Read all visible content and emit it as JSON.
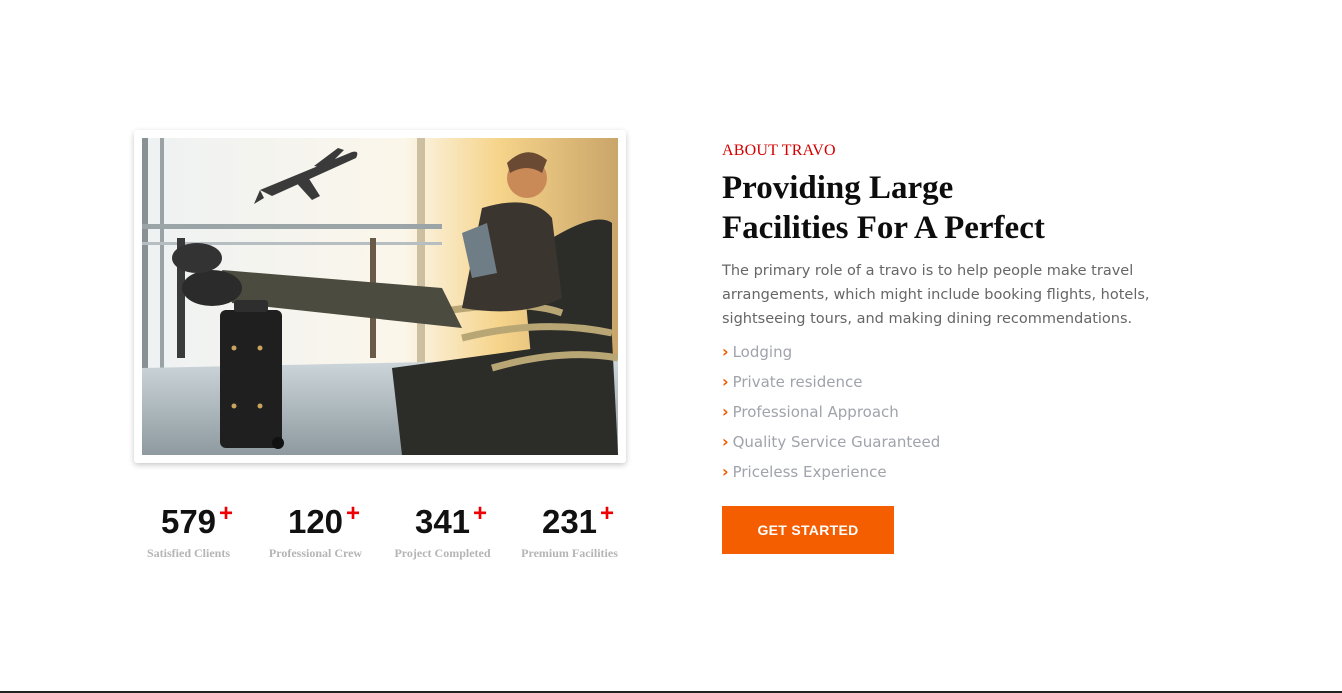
{
  "about": {
    "eyebrow": "ABOUT TRAVO",
    "heading_line1": "Providing Large",
    "heading_line2": "Facilities For A Perfect",
    "description": "The primary role of a travo is to help people make travel arrangements, which might include booking flights, hotels, sightseeing tours, and making dining recommendations.",
    "features": [
      "Lodging",
      "Private residence",
      "Professional Approach",
      "Quality Service Guaranteed",
      "Priceless Experience"
    ],
    "feature_icon": "chevron-right-icon",
    "cta_label": "GET STARTED"
  },
  "stats": [
    {
      "value": "579",
      "suffix": "+",
      "label": "Satisfied Clients"
    },
    {
      "value": "120",
      "suffix": "+",
      "label": "Professional Crew"
    },
    {
      "value": "341",
      "suffix": "+",
      "label": "Project Completed"
    },
    {
      "value": "231",
      "suffix": "+",
      "label": "Premium Facilities"
    }
  ],
  "image": {
    "subject": "traveler-at-airport-photo"
  },
  "colors": {
    "accent": "#f55e00",
    "eyebrow": "#d40000",
    "plus": "#ee0000",
    "heading": "#0d0d0d",
    "muted": "#a0a3ab"
  }
}
